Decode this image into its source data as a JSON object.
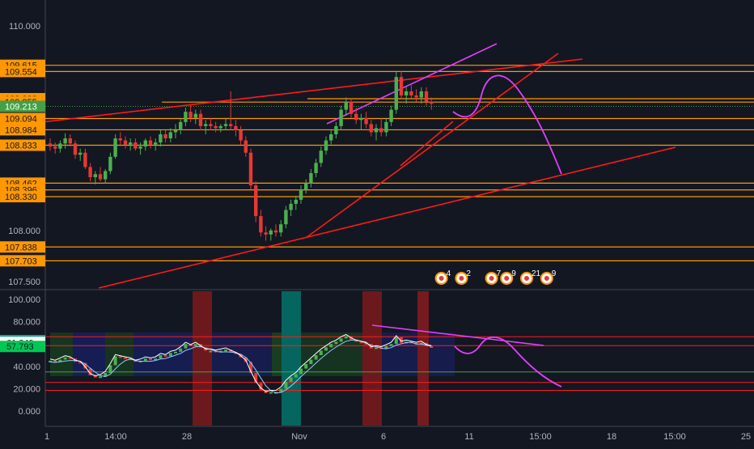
{
  "colors": {
    "background": "#131722",
    "axis_text": "#b2b5be",
    "bull": "#26a69a",
    "bear": "#ef5350",
    "bull_candle": "#4caf50",
    "bear_candle": "#e53935",
    "orange_level": "#ff9800",
    "trend_red": "#ff1a1a",
    "magenta": "#e040fb",
    "current_price": "#43a047",
    "rsi_main": "#ffffff"
  },
  "price_pane": {
    "y_ticks": [
      "110.000",
      "108.000",
      "107.500"
    ],
    "level_labels": [
      {
        "text": "109.615",
        "value": 109.615,
        "style": "orange"
      },
      {
        "text": "109.554",
        "value": 109.554,
        "style": "orange"
      },
      {
        "text": "109.288",
        "value": 109.288,
        "style": "orange"
      },
      {
        "text": "109.255",
        "value": 109.255,
        "style": "orange"
      },
      {
        "text": "109.213",
        "value": 109.213,
        "style": "green"
      },
      {
        "text": "109.094",
        "value": 109.094,
        "style": "orange"
      },
      {
        "text": "108.984",
        "value": 108.984,
        "style": "orange"
      },
      {
        "text": "108.833",
        "value": 108.833,
        "style": "orange"
      },
      {
        "text": "108.462",
        "value": 108.462,
        "style": "orange"
      },
      {
        "text": "108.396",
        "value": 108.396,
        "style": "orange"
      },
      {
        "text": "108.330",
        "value": 108.33,
        "style": "orange"
      },
      {
        "text": "107.838",
        "value": 107.838,
        "style": "orange"
      },
      {
        "text": "107.703",
        "value": 107.703,
        "style": "orange"
      }
    ],
    "event_badges": [
      {
        "text": "4",
        "bar": 78
      },
      {
        "text": "2",
        "bar": 82
      },
      {
        "text": "7",
        "bar": 88
      },
      {
        "text": "9",
        "bar": 91
      },
      {
        "text": "21",
        "bar": 95
      },
      {
        "text": "9",
        "bar": 99
      }
    ]
  },
  "rsi_pane": {
    "y_ticks": [
      "100.000",
      "80.000",
      "40.000",
      "20.000",
      "0.000"
    ],
    "labels": [
      {
        "text": "62.985",
        "value": 62.985,
        "style": "teal"
      },
      {
        "text": "61.349",
        "value": 61.349,
        "style": "white"
      },
      {
        "text": "57.793",
        "value": 57.793,
        "style": "green"
      }
    ],
    "h_lines": [
      {
        "value": 66.5,
        "color": "red"
      },
      {
        "value": 58.5,
        "color": "red"
      },
      {
        "value": 35,
        "color": "green"
      },
      {
        "value": 25.5,
        "color": "red"
      },
      {
        "value": 18.5,
        "color": "red"
      }
    ]
  },
  "x_axis": {
    "ticks": [
      "1",
      "14:00",
      "28",
      "Nov",
      "6",
      "11",
      "15:00",
      "18",
      "15:00",
      "25"
    ]
  },
  "chart_data": {
    "type": "candlestick",
    "title": "",
    "y_range": [
      107.45,
      110.2
    ],
    "rsi_range": [
      -5,
      105
    ],
    "candles": [
      [
        108.85,
        108.9,
        108.78,
        108.82
      ],
      [
        108.82,
        108.86,
        108.75,
        108.8
      ],
      [
        108.8,
        108.88,
        108.76,
        108.85
      ],
      [
        108.85,
        108.95,
        108.8,
        108.9
      ],
      [
        108.9,
        108.94,
        108.82,
        108.85
      ],
      [
        108.85,
        108.88,
        108.7,
        108.74
      ],
      [
        108.74,
        108.8,
        108.68,
        108.76
      ],
      [
        108.76,
        108.8,
        108.6,
        108.62
      ],
      [
        108.62,
        108.66,
        108.48,
        108.52
      ],
      [
        108.52,
        108.58,
        108.45,
        108.55
      ],
      [
        108.55,
        108.62,
        108.48,
        108.5
      ],
      [
        108.5,
        108.6,
        108.46,
        108.58
      ],
      [
        108.58,
        108.76,
        108.55,
        108.72
      ],
      [
        108.72,
        108.94,
        108.7,
        108.9
      ],
      [
        108.9,
        108.96,
        108.84,
        108.88
      ],
      [
        108.88,
        108.92,
        108.8,
        108.84
      ],
      [
        108.84,
        108.9,
        108.78,
        108.86
      ],
      [
        108.86,
        108.9,
        108.78,
        108.8
      ],
      [
        108.8,
        108.86,
        108.74,
        108.82
      ],
      [
        108.82,
        108.9,
        108.78,
        108.88
      ],
      [
        108.88,
        108.92,
        108.8,
        108.84
      ],
      [
        108.84,
        108.9,
        108.78,
        108.86
      ],
      [
        108.86,
        108.98,
        108.82,
        108.94
      ],
      [
        108.94,
        108.98,
        108.86,
        108.9
      ],
      [
        108.9,
        109.0,
        108.86,
        108.96
      ],
      [
        108.96,
        109.04,
        108.9,
        108.98
      ],
      [
        108.98,
        109.1,
        108.94,
        109.06
      ],
      [
        109.06,
        109.2,
        109.02,
        109.16
      ],
      [
        109.16,
        109.22,
        109.06,
        109.1
      ],
      [
        109.1,
        109.18,
        109.04,
        109.14
      ],
      [
        109.14,
        109.18,
        108.98,
        109.02
      ],
      [
        109.02,
        109.08,
        108.94,
        109.04
      ],
      [
        109.04,
        109.1,
        108.98,
        109.02
      ],
      [
        109.02,
        109.06,
        108.96,
        109.0
      ],
      [
        109.0,
        109.04,
        108.96,
        109.02
      ],
      [
        109.02,
        109.1,
        108.98,
        109.04
      ],
      [
        109.04,
        109.36,
        108.98,
        109.02
      ],
      [
        109.02,
        109.08,
        108.92,
        108.98
      ],
      [
        108.98,
        109.02,
        108.84,
        108.88
      ],
      [
        108.88,
        108.92,
        108.72,
        108.76
      ],
      [
        108.76,
        108.8,
        108.4,
        108.44
      ],
      [
        108.44,
        108.48,
        108.08,
        108.14
      ],
      [
        108.14,
        108.2,
        107.94,
        107.98
      ],
      [
        107.98,
        108.04,
        107.9,
        107.96
      ],
      [
        107.96,
        108.02,
        107.9,
        108.0
      ],
      [
        108.0,
        108.06,
        107.94,
        107.98
      ],
      [
        107.98,
        108.1,
        107.94,
        108.06
      ],
      [
        108.06,
        108.24,
        108.02,
        108.2
      ],
      [
        108.2,
        108.3,
        108.14,
        108.26
      ],
      [
        108.26,
        108.34,
        108.2,
        108.3
      ],
      [
        108.3,
        108.44,
        108.26,
        108.4
      ],
      [
        108.4,
        108.5,
        108.36,
        108.46
      ],
      [
        108.46,
        108.6,
        108.42,
        108.56
      ],
      [
        108.56,
        108.7,
        108.52,
        108.66
      ],
      [
        108.66,
        108.82,
        108.62,
        108.78
      ],
      [
        108.78,
        108.92,
        108.74,
        108.88
      ],
      [
        108.88,
        108.98,
        108.84,
        108.94
      ],
      [
        108.94,
        109.06,
        108.9,
        109.02
      ],
      [
        109.02,
        109.22,
        108.98,
        109.18
      ],
      [
        109.18,
        109.3,
        109.12,
        109.26
      ],
      [
        109.26,
        109.28,
        109.1,
        109.14
      ],
      [
        109.14,
        109.2,
        109.04,
        109.08
      ],
      [
        109.08,
        109.14,
        108.98,
        109.1
      ],
      [
        109.1,
        109.16,
        109.0,
        109.04
      ],
      [
        109.04,
        109.08,
        108.92,
        108.96
      ],
      [
        108.96,
        109.04,
        108.88,
        109.0
      ],
      [
        109.0,
        109.1,
        108.92,
        108.96
      ],
      [
        108.96,
        109.1,
        108.92,
        109.06
      ],
      [
        109.06,
        109.22,
        109.02,
        109.18
      ],
      [
        109.18,
        109.56,
        109.14,
        109.5
      ],
      [
        109.5,
        109.56,
        109.28,
        109.32
      ],
      [
        109.32,
        109.4,
        109.24,
        109.36
      ],
      [
        109.36,
        109.42,
        109.28,
        109.32
      ],
      [
        109.32,
        109.38,
        109.26,
        109.3
      ],
      [
        109.3,
        109.4,
        109.24,
        109.36
      ],
      [
        109.36,
        109.4,
        109.22,
        109.26
      ],
      [
        109.26,
        109.3,
        109.18,
        109.24
      ]
    ],
    "rsi_values": [
      45,
      44,
      46,
      48,
      47,
      44,
      43,
      38,
      32,
      30,
      31,
      34,
      41,
      49,
      48,
      47,
      46,
      44,
      45,
      47,
      46,
      47,
      50,
      49,
      52,
      53,
      56,
      60,
      58,
      60,
      57,
      54,
      54,
      53,
      54,
      55,
      53,
      51,
      48,
      44,
      34,
      25,
      19,
      16,
      17,
      17,
      20,
      26,
      30,
      33,
      38,
      42,
      46,
      50,
      54,
      57,
      60,
      62,
      65,
      67,
      64,
      62,
      61,
      60,
      56,
      57,
      56,
      58,
      60,
      66,
      61,
      62,
      61,
      60,
      61,
      58,
      57
    ]
  }
}
